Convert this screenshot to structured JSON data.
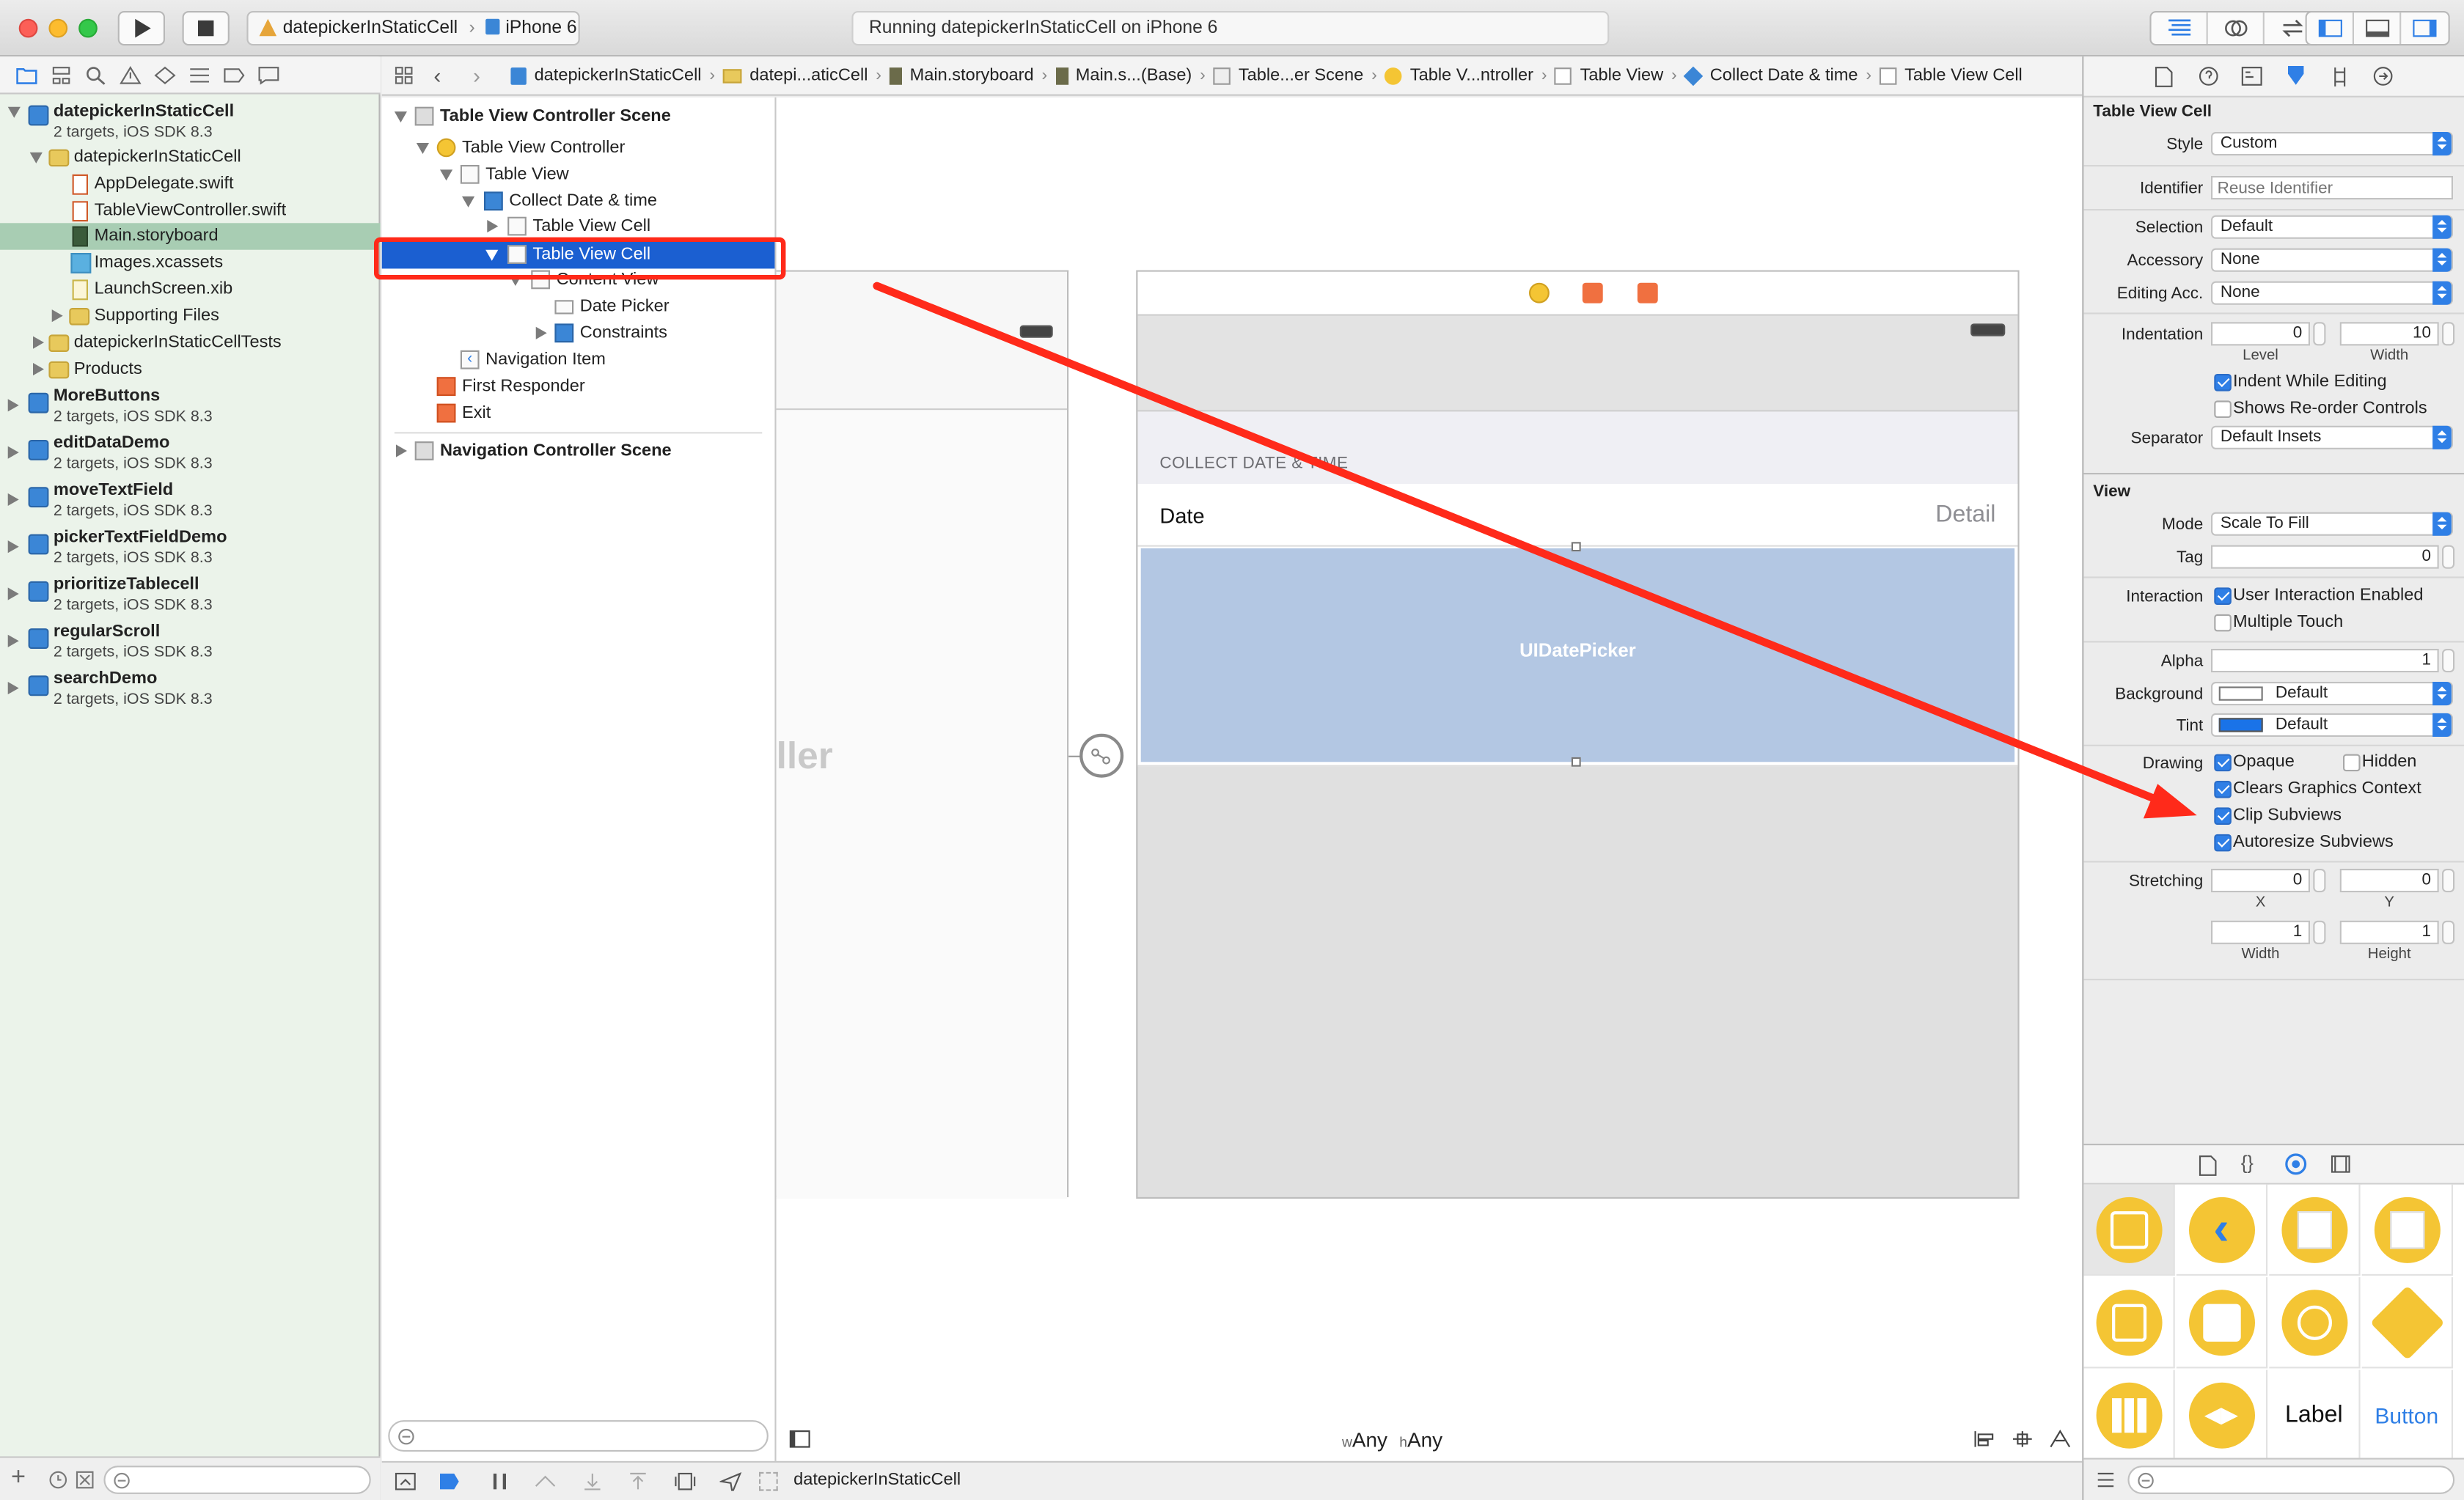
{
  "toolbar": {
    "scheme_project": "datepickerInStaticCell",
    "scheme_device": "iPhone 6",
    "activity_text": "Running datepickerInStaticCell on iPhone 6"
  },
  "navigator": {
    "items": [
      {
        "name": "datepickerInStaticCell",
        "subtitle": "2 targets, iOS SDK 8.3"
      },
      {
        "name": "datepickerInStaticCell"
      },
      {
        "name": "AppDelegate.swift"
      },
      {
        "name": "TableViewController.swift"
      },
      {
        "name": "Main.storyboard"
      },
      {
        "name": "Images.xcassets"
      },
      {
        "name": "LaunchScreen.xib"
      },
      {
        "name": "Supporting Files"
      },
      {
        "name": "datepickerInStaticCellTests"
      },
      {
        "name": "Products"
      }
    ],
    "projects": [
      {
        "name": "MoreButtons",
        "subtitle": "2 targets, iOS SDK 8.3"
      },
      {
        "name": "editDataDemo",
        "subtitle": "2 targets, iOS SDK 8.3"
      },
      {
        "name": "moveTextField",
        "subtitle": "2 targets, iOS SDK 8.3"
      },
      {
        "name": "pickerTextFieldDemo",
        "subtitle": "2 targets, iOS SDK 8.3"
      },
      {
        "name": "prioritizeTablecell",
        "subtitle": "2 targets, iOS SDK 8.3"
      },
      {
        "name": "regularScroll",
        "subtitle": "2 targets, iOS SDK 8.3"
      },
      {
        "name": "searchDemo",
        "subtitle": "2 targets, iOS SDK 8.3"
      }
    ]
  },
  "jumpbar": [
    "datepickerInStaticCell",
    "datepi...aticCell",
    "Main.storyboard",
    "Main.s...(Base)",
    "Table...er Scene",
    "Table V...ntroller",
    "Table View",
    "Collect Date & time",
    "Table View Cell"
  ],
  "outline": [
    "Table View Controller Scene",
    "Table View Controller",
    "Table View",
    "Collect Date & time",
    "Table View Cell",
    "Table View Cell",
    "Content View",
    "Date Picker",
    "Constraints",
    "Navigation Item",
    "First Responder",
    "Exit",
    "Navigation Controller Scene"
  ],
  "canvas": {
    "left_scene_fragment": "ller",
    "section_header": "COLLECT DATE & TIME",
    "cell_title": "Date",
    "cell_detail": "Detail",
    "date_picker_label": "UIDatePicker",
    "size_w_prefix": "w",
    "size_w": "Any",
    "size_h_prefix": "h",
    "size_h": "Any"
  },
  "bottombar": {
    "target": "datepickerInStaticCell"
  },
  "inspector": {
    "section_cell": "Table View Cell",
    "style_label": "Style",
    "style_value": "Custom",
    "identifier_label": "Identifier",
    "identifier_placeholder": "Reuse Identifier",
    "selection_label": "Selection",
    "selection_value": "Default",
    "accessory_label": "Accessory",
    "accessory_value": "None",
    "editing_acc_label": "Editing Acc.",
    "editing_acc_value": "None",
    "indentation_label": "Indentation",
    "indent_level": "0",
    "indent_width": "10",
    "level_caption": "Level",
    "width_caption": "Width",
    "indent_while_editing": "Indent While Editing",
    "shows_reorder": "Shows Re-order Controls",
    "separator_label": "Separator",
    "separator_value": "Default Insets",
    "section_view": "View",
    "mode_label": "Mode",
    "mode_value": "Scale To Fill",
    "tag_label": "Tag",
    "tag_value": "0",
    "interaction_label": "Interaction",
    "user_interaction": "User Interaction Enabled",
    "multiple_touch": "Multiple Touch",
    "alpha_label": "Alpha",
    "alpha_value": "1",
    "background_label": "Background",
    "background_value": "Default",
    "tint_label": "Tint",
    "tint_value": "Default",
    "drawing_label": "Drawing",
    "opaque": "Opaque",
    "hidden": "Hidden",
    "clears_graphics": "Clears Graphics Context",
    "clip_subviews": "Clip Subviews",
    "autoresize": "Autoresize Subviews",
    "stretching_label": "Stretching",
    "stretch_x": "0",
    "stretch_y": "0",
    "x_caption": "X",
    "y_caption": "Y",
    "stretch_w": "1",
    "stretch_h": "1",
    "w_caption": "Width",
    "h_caption": "Height"
  },
  "library": {
    "label_item": "Label",
    "button_item": "Button"
  },
  "colors": {
    "accent": "#2f7fe6",
    "selection": "#1b5fd1",
    "annotation": "#ff2a1a",
    "library_badge": "#f4c534"
  }
}
